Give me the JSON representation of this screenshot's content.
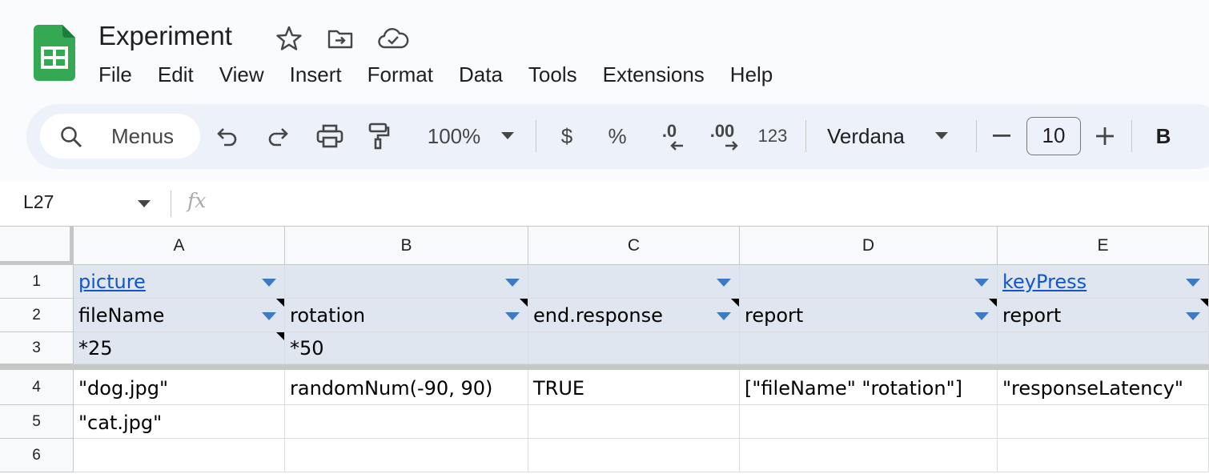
{
  "app": {
    "doc_title": "Experiment",
    "brand_color": "#34a853"
  },
  "menubar": [
    "File",
    "Edit",
    "View",
    "Insert",
    "Format",
    "Data",
    "Tools",
    "Extensions",
    "Help"
  ],
  "toolbar": {
    "search_label": "Menus",
    "zoom": "100%",
    "currency": "$",
    "percent": "%",
    "decrease_decimal": ".0",
    "increase_decimal": ".00",
    "number_format": "123",
    "font": "Verdana",
    "font_size": "10",
    "bold": "B"
  },
  "formula_bar": {
    "cell_ref": "L27",
    "fx": "fx",
    "content": ""
  },
  "grid": {
    "columns": [
      "A",
      "B",
      "C",
      "D",
      "E"
    ],
    "row_numbers": [
      "1",
      "2",
      "3",
      "4",
      "5",
      "6"
    ],
    "rows": [
      [
        "picture",
        "",
        "",
        "",
        "keyPress"
      ],
      [
        "fileName",
        "rotation",
        "end.response",
        "report",
        "report"
      ],
      [
        "*25",
        "*50",
        "",
        "",
        ""
      ],
      [
        "\"dog.jpg\"",
        "randomNum(-90, 90)",
        "TRUE",
        "[\"fileName\" \"rotation\"]",
        "\"responseLatency\""
      ],
      [
        "\"cat.jpg\"",
        "",
        "",
        "",
        ""
      ],
      [
        "",
        "",
        "",
        "",
        ""
      ]
    ],
    "header_fill": "#dfe6f0",
    "link_color": "#1155cc"
  }
}
